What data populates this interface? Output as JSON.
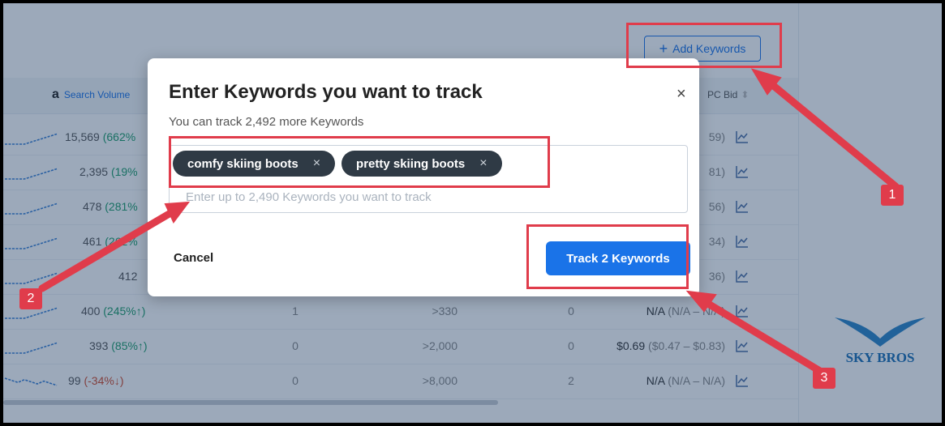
{
  "toolbar": {
    "add_keywords_label": "Add Keywords"
  },
  "table": {
    "header_search_volume": "Search Volume",
    "header_cpc_bid": "PC Bid",
    "rows": [
      {
        "volume": "15,569",
        "change": "(662%",
        "dir": "up"
      },
      {
        "volume": "2,395",
        "change": "(19%",
        "dir": "up"
      },
      {
        "volume": "478",
        "change": "(281%",
        "dir": "up"
      },
      {
        "volume": "461",
        "change": "(262%",
        "dir": "up"
      },
      {
        "volume": "412",
        "change": "",
        "dir": "up"
      },
      {
        "volume": "400",
        "change": "(245%↑)",
        "dir": "up",
        "c1": "1",
        "c2": ">330",
        "c3": "0",
        "cpc": "N/A",
        "cpc_range": "(N/A – N/A)"
      },
      {
        "volume": "393",
        "change": "(85%↑)",
        "dir": "up",
        "c1": "0",
        "c2": ">2,000",
        "c3": "0",
        "cpc": "$0.69",
        "cpc_range": "($0.47 – $0.83)"
      },
      {
        "volume": "99",
        "change": "(-34%↓)",
        "dir": "down",
        "c1": "0",
        "c2": ">8,000",
        "c3": "2",
        "cpc": "N/A",
        "cpc_range": "(N/A – N/A)"
      }
    ],
    "partial_cpc": [
      "59)",
      "81)",
      "56)",
      "34)",
      "36)"
    ]
  },
  "modal": {
    "title": "Enter Keywords you want to track",
    "subtitle": "You can track 2,492 more Keywords",
    "chips": [
      "comfy skiing boots",
      "pretty skiing boots"
    ],
    "chip_remove": "×",
    "placeholder": "Enter up to 2,490 Keywords you want to track",
    "cancel_label": "Cancel",
    "track_label": "Track 2 Keywords",
    "close": "×"
  },
  "annotations": {
    "badge_1": "1",
    "badge_2": "2",
    "badge_3": "3"
  },
  "logo": {
    "text": "SKY BROS"
  },
  "colors": {
    "accent": "#1a73e8",
    "annotation": "#e03c4b",
    "chip": "#2f3a45"
  }
}
